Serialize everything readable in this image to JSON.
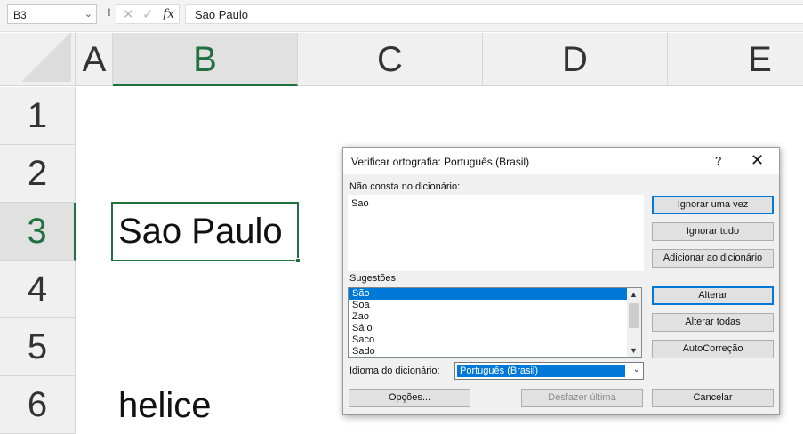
{
  "formula_bar": {
    "name_box": "B3",
    "name_box_chevron": "⌄",
    "cancel_glyph": "✕",
    "enter_glyph": "✓",
    "fx_glyph": "fx",
    "formula": "Sao Paulo"
  },
  "grid": {
    "columns": [
      "A",
      "B",
      "C",
      "D",
      "E"
    ],
    "rows": [
      "1",
      "2",
      "3",
      "4",
      "5",
      "6"
    ],
    "selected_column": "B",
    "selected_row": "3",
    "cells": {
      "B3": "Sao Paulo",
      "B6": "helice"
    },
    "accent_color": "#21703f"
  },
  "dialog": {
    "title": "Verificar ortografia: Português (Brasil)",
    "help_glyph": "?",
    "close_glyph": "✕",
    "not_found_label": "Não consta no dicionário:",
    "not_found_word": "Sao",
    "suggestions_label": "Sugestões:",
    "suggestions": [
      "São",
      "Soa",
      "Zao",
      "Sá o",
      "Saco",
      "Sado"
    ],
    "selected_suggestion": "São",
    "language_label": "Idioma do dicionário:",
    "language_value": "Português (Brasil)",
    "buttons": {
      "ignore_once": "Ignorar uma vez",
      "ignore_all": "Ignorar tudo",
      "add_to_dictionary": "Adicionar ao dicionário",
      "change": "Alterar",
      "change_all": "Alterar todas",
      "autocorrect": "AutoCorreção",
      "options": "Opções...",
      "undo_last": "Desfazer última",
      "cancel": "Cancelar"
    },
    "accent_color": "#0078d7"
  }
}
